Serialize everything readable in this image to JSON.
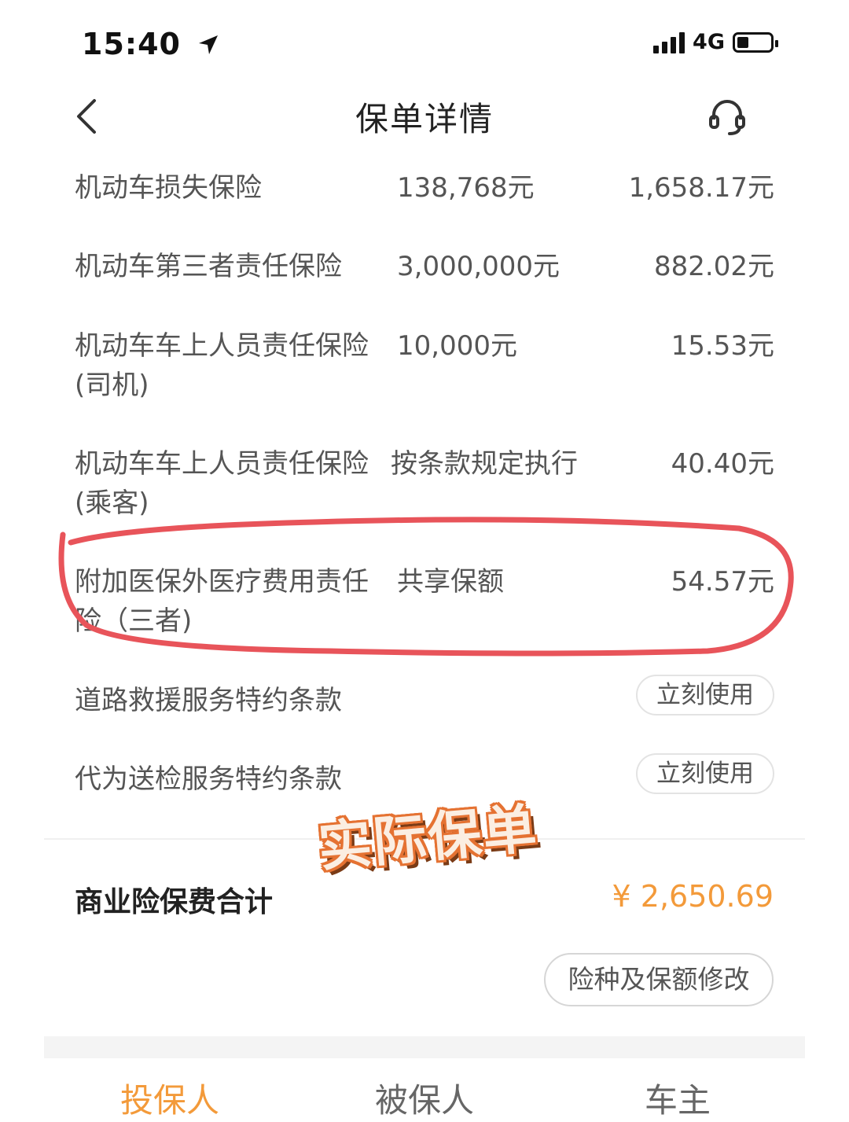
{
  "status": {
    "time": "15:40",
    "network": "4G"
  },
  "nav": {
    "title": "保单详情"
  },
  "rows": [
    {
      "name": "机动车损失保险",
      "amount": "138,768元",
      "premium": "1,658.17元"
    },
    {
      "name": "机动车第三者责任保险",
      "amount": "3,000,000元",
      "premium": "882.02元"
    },
    {
      "name": "机动车车上人员责任保险(司机)",
      "amount": "10,000元",
      "premium": "15.53元"
    },
    {
      "name": "机动车车上人员责任保险(乘客)",
      "amount": "按条款规定执行",
      "premium": "40.40元"
    },
    {
      "name": "附加医保外医疗费用责任险（三者)",
      "amount": "共享保额",
      "premium": "54.57元"
    }
  ],
  "services": [
    {
      "name": "道路救援服务特约条款",
      "button": "立刻使用"
    },
    {
      "name": "代为送检服务特约条款",
      "button": "立刻使用"
    }
  ],
  "stamp": "实际保单",
  "total": {
    "label": "商业险保费合计",
    "value": "¥ 2,650.69"
  },
  "modify_button": "险种及保额修改",
  "tabs": [
    {
      "label": "投保人",
      "active": true
    },
    {
      "label": "被保人",
      "active": false
    },
    {
      "label": "车主",
      "active": false
    }
  ],
  "colors": {
    "accent": "#f39a3a",
    "highlight": "#e8545a",
    "stamp_fill": "#fbeee2",
    "stamp_outline": "#e57232"
  },
  "icons": [
    "back-arrow-icon",
    "headset-icon",
    "signal-icon",
    "location-arrow-icon",
    "battery-icon"
  ]
}
